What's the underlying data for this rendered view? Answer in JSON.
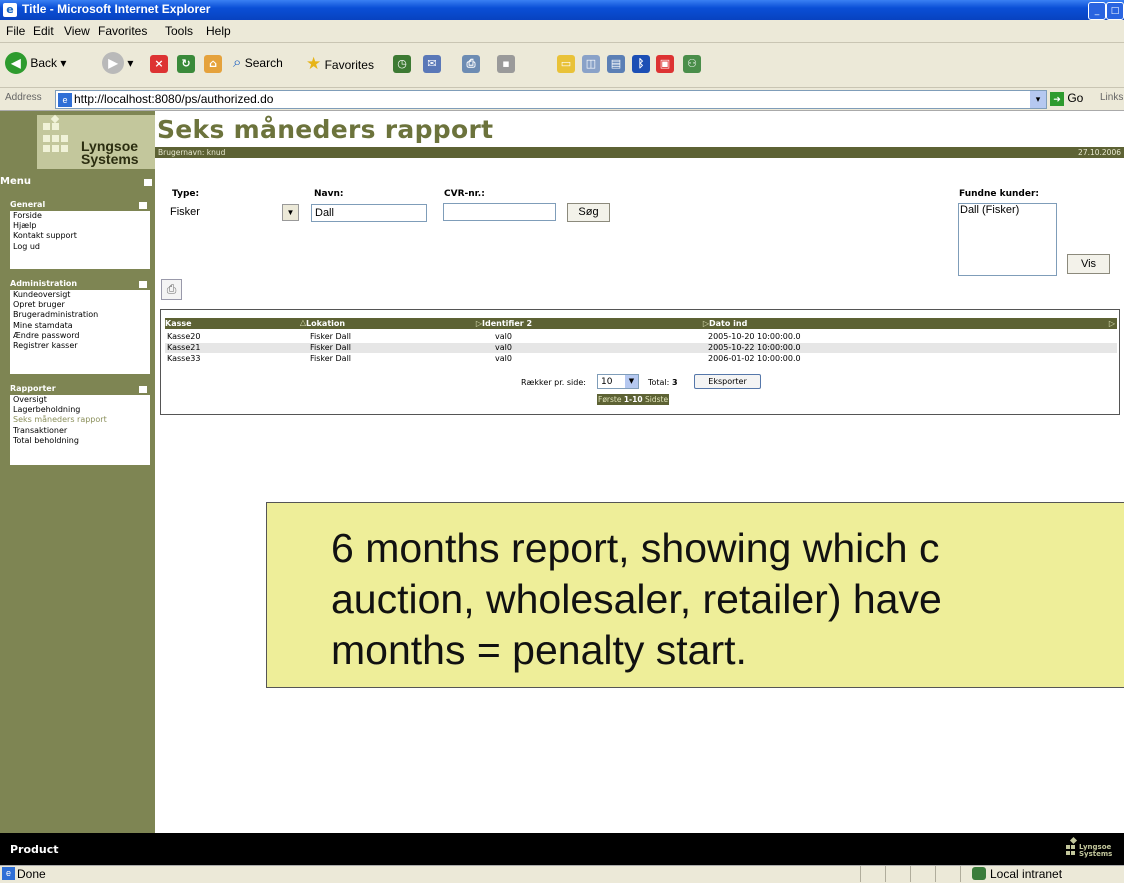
{
  "window": {
    "title": "Title - Microsoft Internet Explorer"
  },
  "menu": [
    "File",
    "Edit",
    "View",
    "Favorites",
    "Tools",
    "Help"
  ],
  "toolbar": {
    "back": "Back",
    "search": "Search",
    "favorites": "Favorites"
  },
  "address": {
    "label": "Address",
    "url": "http://localhost:8080/ps/authorized.do",
    "go": "Go",
    "links": "Links"
  },
  "logo": {
    "line1": "Lyngsoe",
    "line2": "Systems"
  },
  "page": {
    "title": "Seks måneders rapport",
    "username": "Brugernavn: knud",
    "date": "27.10.2006"
  },
  "sidebar": {
    "menu_label": "Menu",
    "sections": [
      {
        "title": "General",
        "items": [
          "Forside",
          "Hjælp",
          "Kontakt support",
          "Log ud"
        ]
      },
      {
        "title": "Administration",
        "items": [
          "Kundeoversigt",
          "Opret bruger",
          "Brugeradministration",
          "Mine stamdata",
          "Ændre password",
          "Registrer kasser"
        ]
      },
      {
        "title": "Rapporter",
        "items": [
          "Oversigt",
          "Lagerbeholdning",
          "Seks måneders rapport",
          "Transaktioner",
          "Total beholdning"
        ]
      }
    ]
  },
  "search": {
    "type_label": "Type:",
    "type_value": "Fisker",
    "navn_label": "Navn:",
    "navn_value": "Dall",
    "cvr_label": "CVR-nr.:",
    "cvr_value": "",
    "search_button": "Søg",
    "found_label": "Fundne kunder:",
    "found_items": [
      "Dall (Fisker)"
    ],
    "show_button": "Vis"
  },
  "table": {
    "columns": [
      "Kasse",
      "Lokation",
      "Identifier 2",
      "Dato ind"
    ],
    "rows": [
      [
        "Kasse20",
        "Fisker Dall",
        "val0",
        "2005-10-20 10:00:00.0"
      ],
      [
        "Kasse21",
        "Fisker Dall",
        "val0",
        "2005-10-22 10:00:00.0"
      ],
      [
        "Kasse33",
        "Fisker Dall",
        "val0",
        "2006-01-02 10:00:00.0"
      ]
    ],
    "rows_per_page_label": "Rækker pr. side:",
    "rows_per_page": "10",
    "total_label": "Total:",
    "total": "3",
    "export_button": "Eksporter",
    "pager": [
      "Første",
      "1-10",
      "Sidste"
    ]
  },
  "callout": {
    "line1": "6 months report, showing which c",
    "line2": "auction, wholesaler, retailer) have",
    "line3": "months = penalty start."
  },
  "footer": {
    "label": "Product",
    "logo1": "Lyngsoe",
    "logo2": "Systems"
  },
  "status": {
    "left": "Done",
    "zone": "Local intranet"
  }
}
